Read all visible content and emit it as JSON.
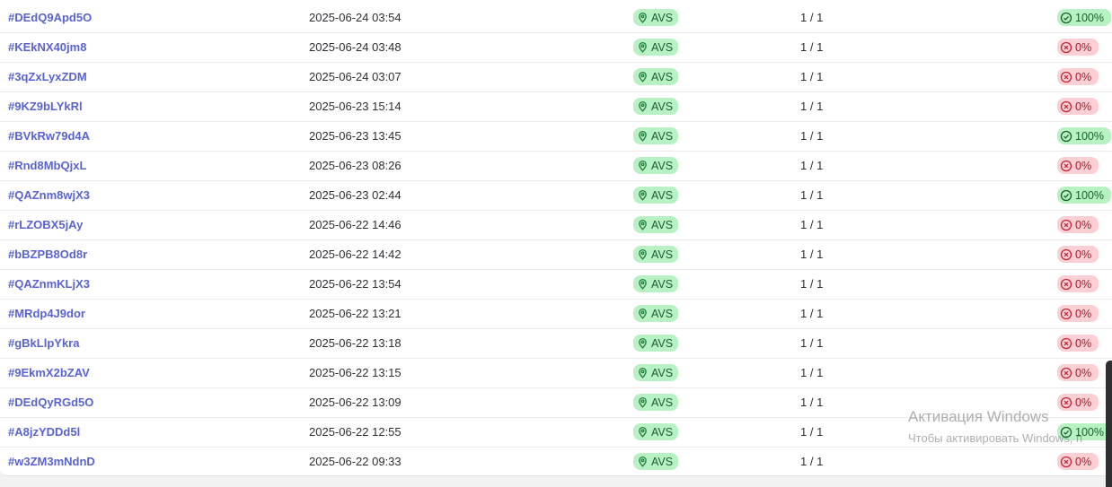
{
  "table": {
    "rows": [
      {
        "id": "#DEdQ9Apd5O",
        "date": "2025-06-24 03:54",
        "type": "AVS",
        "count": "1 / 1",
        "score": "100%",
        "status": "ok"
      },
      {
        "id": "#KEkNX40jm8",
        "date": "2025-06-24 03:48",
        "type": "AVS",
        "count": "1 / 1",
        "score": "0%",
        "status": "fail"
      },
      {
        "id": "#3qZxLyxZDM",
        "date": "2025-06-24 03:07",
        "type": "AVS",
        "count": "1 / 1",
        "score": "0%",
        "status": "fail"
      },
      {
        "id": "#9KZ9bLYkRl",
        "date": "2025-06-23 15:14",
        "type": "AVS",
        "count": "1 / 1",
        "score": "0%",
        "status": "fail"
      },
      {
        "id": "#BVkRw79d4A",
        "date": "2025-06-23 13:45",
        "type": "AVS",
        "count": "1 / 1",
        "score": "100%",
        "status": "ok"
      },
      {
        "id": "#Rnd8MbQjxL",
        "date": "2025-06-23 08:26",
        "type": "AVS",
        "count": "1 / 1",
        "score": "0%",
        "status": "fail"
      },
      {
        "id": "#QAZnm8wjX3",
        "date": "2025-06-23 02:44",
        "type": "AVS",
        "count": "1 / 1",
        "score": "100%",
        "status": "ok"
      },
      {
        "id": "#rLZOBX5jAy",
        "date": "2025-06-22 14:46",
        "type": "AVS",
        "count": "1 / 1",
        "score": "0%",
        "status": "fail"
      },
      {
        "id": "#bBZPB8Od8r",
        "date": "2025-06-22 14:42",
        "type": "AVS",
        "count": "1 / 1",
        "score": "0%",
        "status": "fail"
      },
      {
        "id": "#QAZnmKLjX3",
        "date": "2025-06-22 13:54",
        "type": "AVS",
        "count": "1 / 1",
        "score": "0%",
        "status": "fail"
      },
      {
        "id": "#MRdp4J9dor",
        "date": "2025-06-22 13:21",
        "type": "AVS",
        "count": "1 / 1",
        "score": "0%",
        "status": "fail"
      },
      {
        "id": "#gBkLlpYkra",
        "date": "2025-06-22 13:18",
        "type": "AVS",
        "count": "1 / 1",
        "score": "0%",
        "status": "fail"
      },
      {
        "id": "#9EkmX2bZAV",
        "date": "2025-06-22 13:15",
        "type": "AVS",
        "count": "1 / 1",
        "score": "0%",
        "status": "fail"
      },
      {
        "id": "#DEdQyRGd5O",
        "date": "2025-06-22 13:09",
        "type": "AVS",
        "count": "1 / 1",
        "score": "0%",
        "status": "fail"
      },
      {
        "id": "#A8jzYDDd5l",
        "date": "2025-06-22 12:55",
        "type": "AVS",
        "count": "1 / 1",
        "score": "100%",
        "status": "ok"
      },
      {
        "id": "#w3ZM3mNdnD",
        "date": "2025-06-22 09:33",
        "type": "AVS",
        "count": "1 / 1",
        "score": "0%",
        "status": "fail"
      }
    ]
  },
  "watermark": {
    "title": "Активация Windows",
    "subtitle": "Чтобы активировать Windows, п"
  },
  "colors": {
    "link": "#5a63cf",
    "success_bg": "#b8f2c4",
    "fail_bg": "#fbd0d4"
  },
  "icons": {
    "type": "map-pin-icon",
    "ok": "check-circle-icon",
    "fail": "x-circle-icon"
  }
}
